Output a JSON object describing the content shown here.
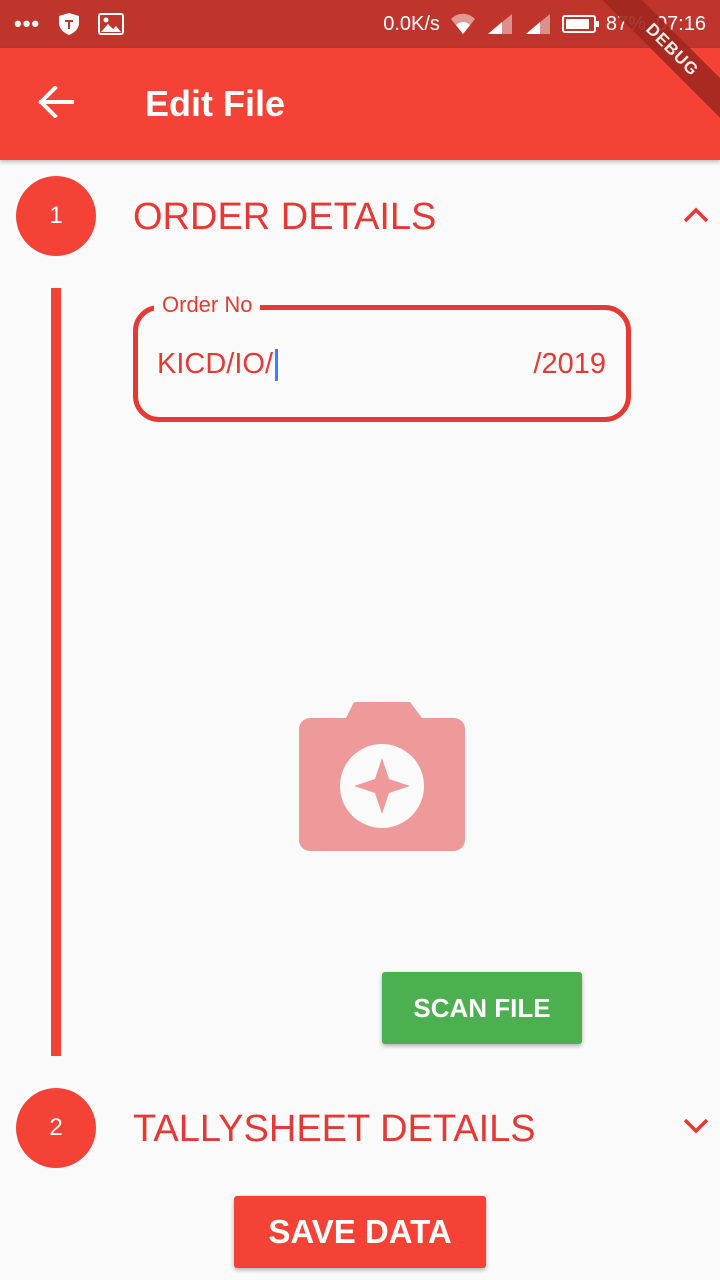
{
  "status_bar": {
    "dots": "•••",
    "net_speed": "0.0K/s",
    "battery": "87%",
    "battery_level": 0.87,
    "time": "07:16",
    "icons": [
      "shield-icon",
      "image-icon",
      "wifi-icon",
      "signal-icon",
      "signal-icon",
      "battery-icon"
    ]
  },
  "app_bar": {
    "title": "Edit File",
    "back_icon": "arrow-back-icon",
    "debug_banner": "DEBUG"
  },
  "steps": [
    {
      "number": "1",
      "title": "ORDER DETAILS",
      "expanded": true,
      "chevron_icon": "chevron-up-icon"
    },
    {
      "number": "2",
      "title": "TALLYSHEET DETAILS",
      "expanded": false,
      "chevron_icon": "chevron-down-icon"
    }
  ],
  "order_field": {
    "label": "Order No",
    "value": "KICD/IO/",
    "suffix": "/2019"
  },
  "camera": {
    "icon": "camera-icon"
  },
  "buttons": {
    "scan": "SCAN FILE",
    "save": "SAVE DATA"
  },
  "colors": {
    "primary": "#f44336",
    "primary_dark": "#c0352b",
    "accent_text": "#e53935",
    "scan_button": "#4caf50",
    "camera_tint": "#ef9a9a",
    "background": "#fafafa"
  }
}
